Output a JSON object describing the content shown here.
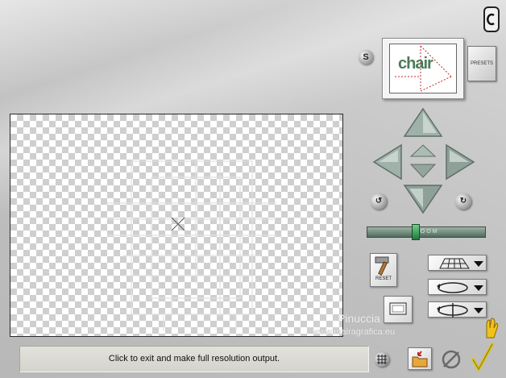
{
  "toolbar": {
    "presets_label": "PRESETS",
    "s_label": "S",
    "reset_label": "RESET",
    "zoom_label": "Z O O M"
  },
  "preview": {
    "word": "chair"
  },
  "status": {
    "text": "Click to exit and make full resolution output."
  },
  "watermark": {
    "name": "Pinuccia",
    "url": "www.mairagrafica.eu"
  },
  "colors": {
    "arrow": "#8fa39a",
    "zoom_knob": "#2f8a4f",
    "ok_check": "#d8c222"
  },
  "icons": [
    "app-logo-icon",
    "arrow-up-icon",
    "arrow-down-icon",
    "arrow-left-icon",
    "arrow-right-icon",
    "center-icon",
    "rotate-left-icon",
    "rotate-right-icon",
    "hammer-icon",
    "grid-plane-icon",
    "rotate-horizontal-icon",
    "rotate-vertical-icon",
    "frame-icon",
    "grid-toggle-icon",
    "open-folder-icon",
    "cancel-icon",
    "ok-check-icon",
    "hand-icon"
  ]
}
